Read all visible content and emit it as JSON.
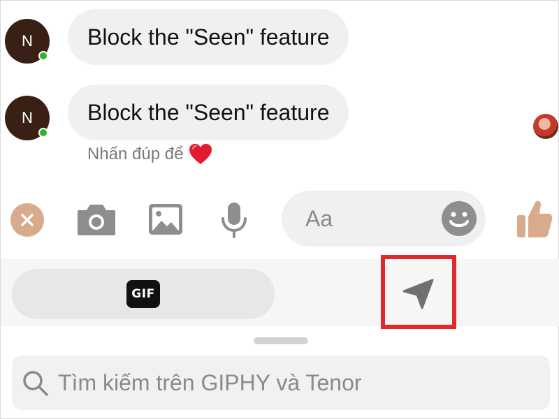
{
  "messages": [
    {
      "sender_initial": "N",
      "text": "Block the \"Seen\" feature"
    },
    {
      "sender_initial": "N",
      "text": "Block the \"Seen\" feature"
    }
  ],
  "hint": {
    "text": "Nhấn đúp để",
    "emoji": "heart-icon"
  },
  "composer": {
    "input_placeholder": "Aa",
    "icons": [
      "close-icon",
      "camera-icon",
      "image-icon",
      "microphone-icon",
      "emoji-icon",
      "like-icon"
    ],
    "accent": "#d8ab8d"
  },
  "tray": {
    "gif_label": "GIF",
    "send_icon": "send-icon",
    "highlight_color": "#e0282d"
  },
  "search": {
    "placeholder": "Tìm kiếm trên GIPHY và Tenor"
  },
  "colors": {
    "online": "#31b22a",
    "bubble": "#f0f0f0",
    "avatar": "#3a1f14"
  }
}
